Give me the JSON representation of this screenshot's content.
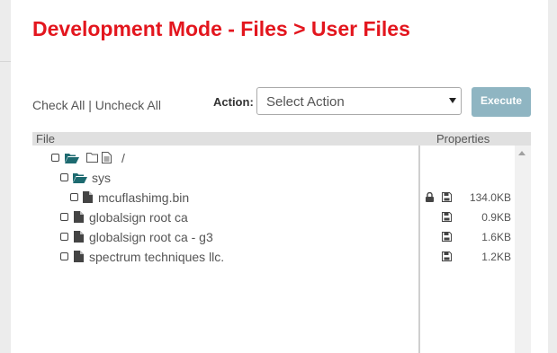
{
  "page": {
    "title": "Development Mode - Files > User Files"
  },
  "toolbar": {
    "check_all": "Check All",
    "separator": "|",
    "uncheck_all": "Uncheck All",
    "action_label": "Action:",
    "action_select_value": "Select Action",
    "execute_label": "Execute"
  },
  "table": {
    "col_file": "File",
    "col_properties": "Properties"
  },
  "tree": {
    "root": {
      "name": "/"
    },
    "sys": {
      "name": "sys"
    },
    "files": [
      {
        "name": "mcuflashimg.bin",
        "size": "134.0KB",
        "locked": true
      },
      {
        "name": "globalsign root ca",
        "size": "0.9KB",
        "locked": false
      },
      {
        "name": "globalsign root ca - g3",
        "size": "1.6KB",
        "locked": false
      },
      {
        "name": "spectrum techniques llc.",
        "size": "1.2KB",
        "locked": false
      }
    ]
  },
  "colors": {
    "title": "#e3161e",
    "folder_icon": "#1d6a70",
    "execute_button": "#8fb5c2"
  }
}
